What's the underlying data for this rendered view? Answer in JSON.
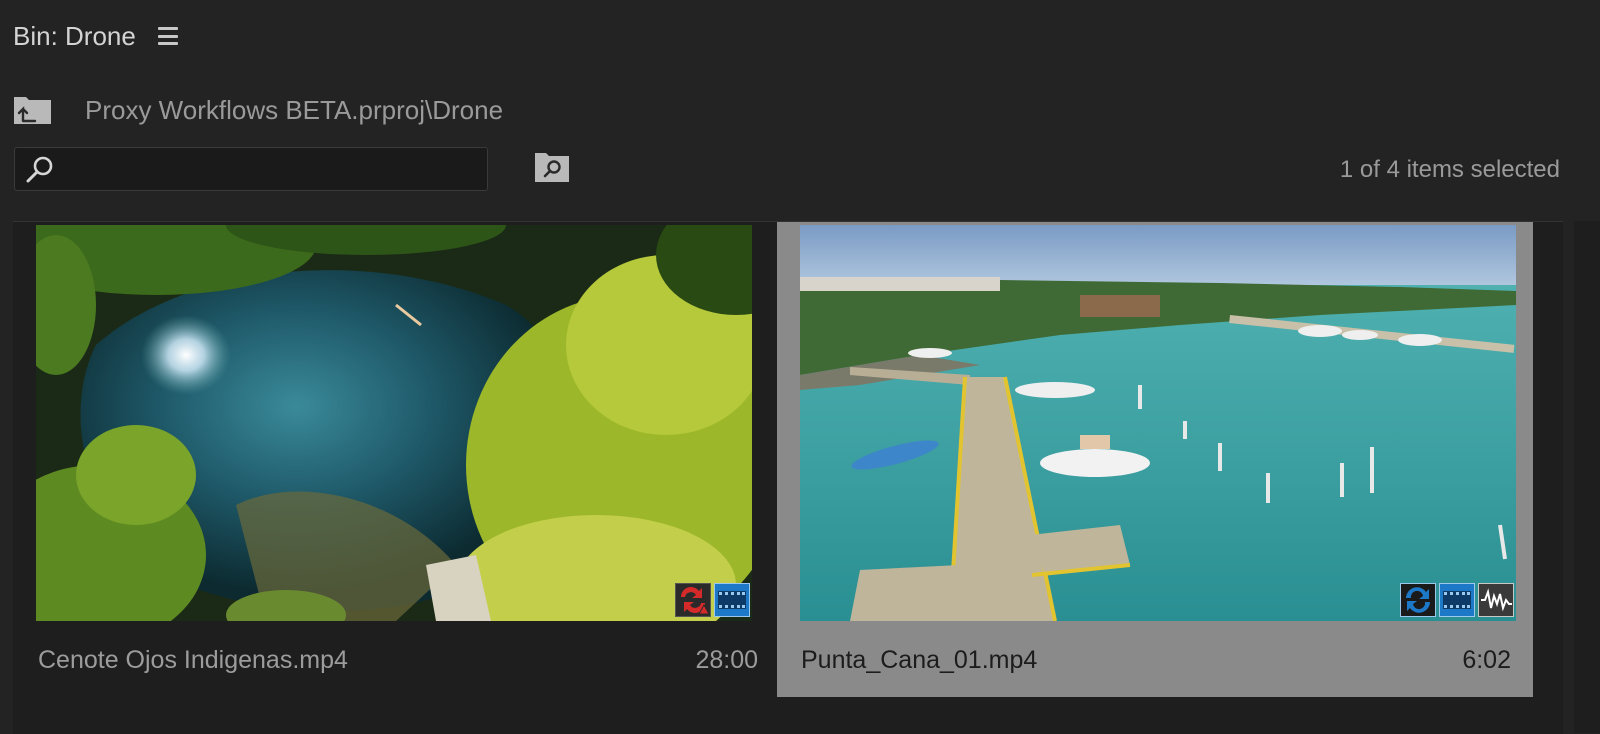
{
  "bin": {
    "title": "Bin: Drone"
  },
  "path": {
    "text": "Proxy Workflows BETA.prproj\\Drone"
  },
  "search": {
    "value": "",
    "placeholder": ""
  },
  "status": {
    "selection_text": "1 of 4 items selected"
  },
  "items": [
    {
      "name": "Cenote Ojos Indigenas.mp4",
      "duration": "28:00",
      "selected": false,
      "badges": [
        "proxy-error-icon",
        "video-icon"
      ]
    },
    {
      "name": "Punta_Cana_01.mp4",
      "duration": "6:02",
      "selected": true,
      "badges": [
        "proxy-attached-icon",
        "video-icon",
        "audio-icon"
      ]
    }
  ],
  "colors": {
    "panel_bg": "#232323",
    "selected_tile": "#8a8a8a",
    "badge_blue": "#1e78c8",
    "badge_red": "#d42a2a"
  }
}
